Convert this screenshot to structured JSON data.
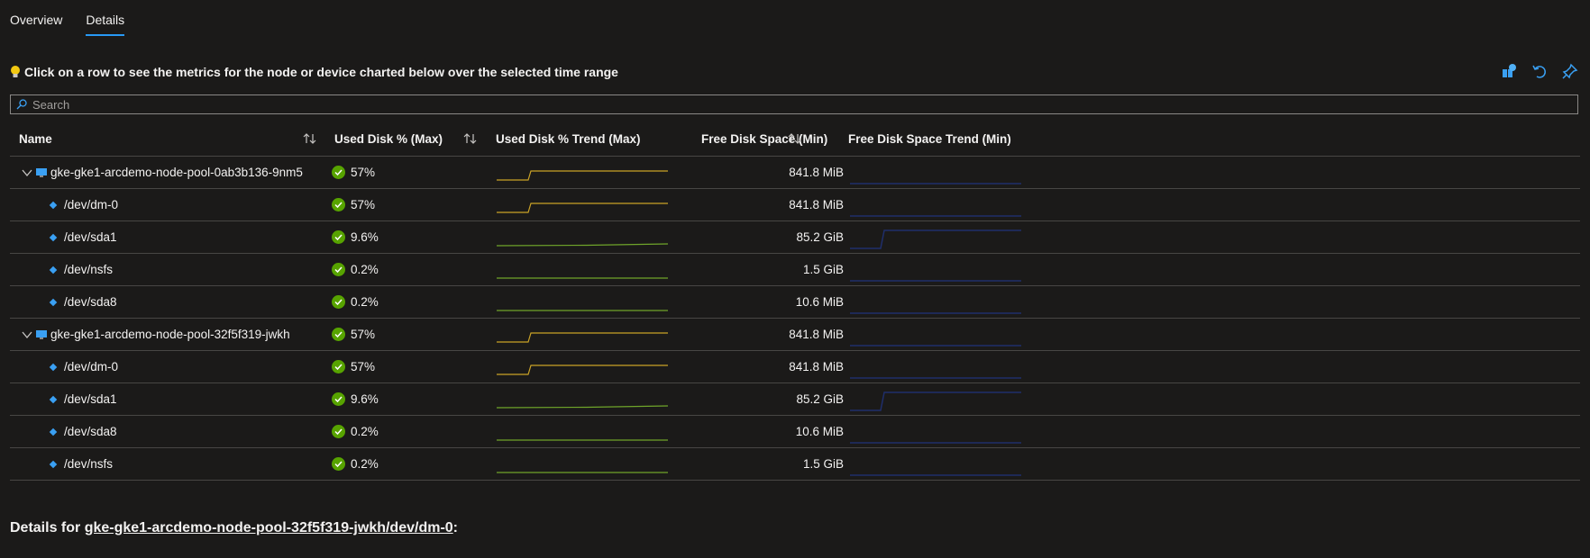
{
  "tabs": [
    {
      "label": "Overview",
      "active": false
    },
    {
      "label": "Details",
      "active": true
    }
  ],
  "hint": "Click on a row to see the metrics for the node or device charted below over the selected time range",
  "search": {
    "placeholder": "Search",
    "value": ""
  },
  "columns": {
    "name": "Name",
    "used": "Used Disk % (Max)",
    "used_trend": "Used Disk % Trend (Max)",
    "free": "Free Disk Space (Min)",
    "free_trend": "Free Disk Space Trend (Min)"
  },
  "rows": [
    {
      "type": "node",
      "name": "gke-gke1-arcdemo-node-pool-0ab3b136-9nm5",
      "used": "57%",
      "free": "841.8 MiB",
      "used_trend": "step",
      "used_color": "#c9a227",
      "free_trend": "flat-low"
    },
    {
      "type": "device",
      "name": "/dev/dm-0",
      "used": "57%",
      "free": "841.8 MiB",
      "used_trend": "step",
      "used_color": "#c9a227",
      "free_trend": "flat-low"
    },
    {
      "type": "device",
      "name": "/dev/sda1",
      "used": "9.6%",
      "free": "85.2 GiB",
      "used_trend": "slight",
      "used_color": "#6fa52a",
      "free_trend": "step"
    },
    {
      "type": "device",
      "name": "/dev/nsfs",
      "used": "0.2%",
      "free": "1.5 GiB",
      "used_trend": "flat",
      "used_color": "#6fa52a",
      "free_trend": "flat-low"
    },
    {
      "type": "device",
      "name": "/dev/sda8",
      "used": "0.2%",
      "free": "10.6 MiB",
      "used_trend": "flat",
      "used_color": "#6fa52a",
      "free_trend": "flat-low"
    },
    {
      "type": "node",
      "name": "gke-gke1-arcdemo-node-pool-32f5f319-jwkh",
      "used": "57%",
      "free": "841.8 MiB",
      "used_trend": "step",
      "used_color": "#c9a227",
      "free_trend": "flat-low"
    },
    {
      "type": "device",
      "name": "/dev/dm-0",
      "used": "57%",
      "free": "841.8 MiB",
      "used_trend": "step",
      "used_color": "#c9a227",
      "free_trend": "flat-low"
    },
    {
      "type": "device",
      "name": "/dev/sda1",
      "used": "9.6%",
      "free": "85.2 GiB",
      "used_trend": "slight",
      "used_color": "#6fa52a",
      "free_trend": "step"
    },
    {
      "type": "device",
      "name": "/dev/sda8",
      "used": "0.2%",
      "free": "10.6 MiB",
      "used_trend": "flat",
      "used_color": "#6fa52a",
      "free_trend": "flat-low"
    },
    {
      "type": "device",
      "name": "/dev/nsfs",
      "used": "0.2%",
      "free": "1.5 GiB",
      "used_trend": "flat",
      "used_color": "#6fa52a",
      "free_trend": "flat-low"
    }
  ],
  "details": {
    "prefix": "Details for ",
    "link": "gke-gke1-arcdemo-node-pool-32f5f319-jwkh/dev/dm-0",
    "suffix": ":"
  },
  "colors": {
    "accent": "#2899f5",
    "ok": "#57a300",
    "free_trend": "#1f2e6b"
  }
}
